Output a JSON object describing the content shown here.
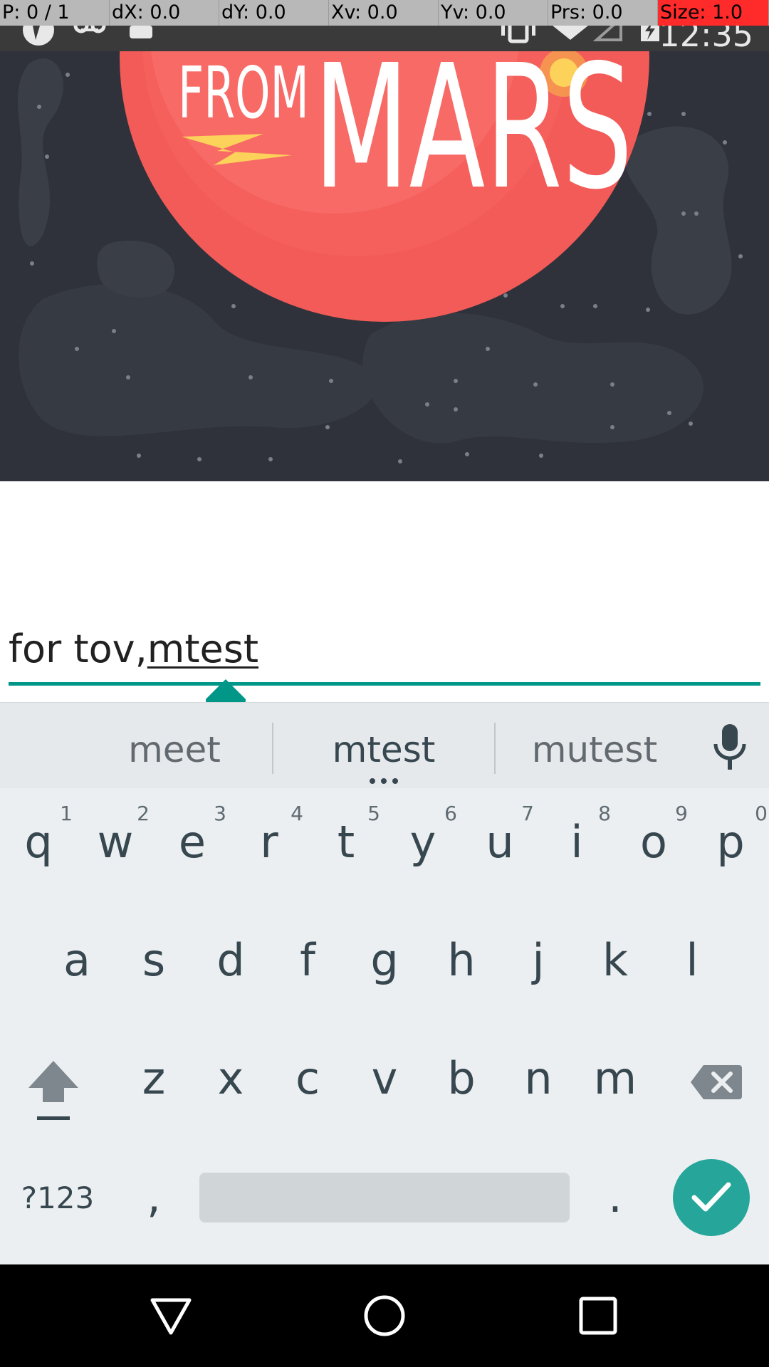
{
  "pointer_overlay": {
    "cells": [
      "P: 0 / 1",
      "dX: 0.0",
      "dY: 0.0",
      "Xv: 0.0",
      "Yv: 0.0",
      "Prs: 0.0",
      "Size: 1.0"
    ]
  },
  "status_bar": {
    "time": "12:35",
    "icons": [
      "app-icon",
      "voicemail-icon",
      "android-icon",
      "vibrate-icon",
      "wifi-icon",
      "signal-icon",
      "battery-charging-icon"
    ]
  },
  "hero": {
    "logo_from": "FROM",
    "logo_mars": "MARS"
  },
  "text_field": {
    "committed_text": "for tov,",
    "composing_text": "mtest"
  },
  "suggestions": {
    "left": "meet",
    "center": "mtest",
    "right": "mutest"
  },
  "keyboard": {
    "row1": [
      {
        "key": "q",
        "hint": "1"
      },
      {
        "key": "w",
        "hint": "2"
      },
      {
        "key": "e",
        "hint": "3"
      },
      {
        "key": "r",
        "hint": "4"
      },
      {
        "key": "t",
        "hint": "5"
      },
      {
        "key": "y",
        "hint": "6"
      },
      {
        "key": "u",
        "hint": "7"
      },
      {
        "key": "i",
        "hint": "8"
      },
      {
        "key": "o",
        "hint": "9"
      },
      {
        "key": "p",
        "hint": "0"
      }
    ],
    "row2": [
      "a",
      "s",
      "d",
      "f",
      "g",
      "h",
      "j",
      "k",
      "l"
    ],
    "row3": [
      "z",
      "x",
      "c",
      "v",
      "b",
      "n",
      "m"
    ],
    "symbols_label": "?123",
    "comma": ",",
    "period": "."
  },
  "colors": {
    "accent": "#009688",
    "enter": "#26a69a",
    "planet": "#f25b57",
    "space": "#2f323a"
  }
}
